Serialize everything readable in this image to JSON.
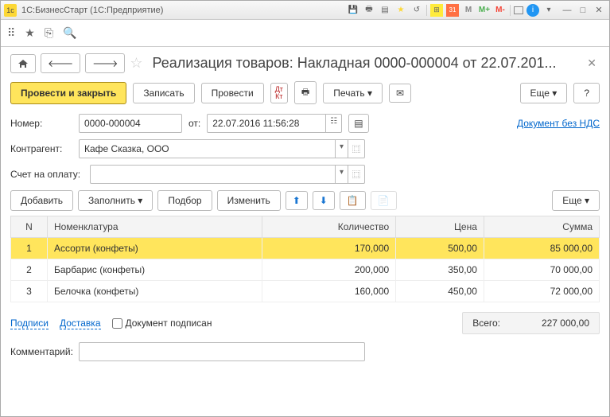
{
  "titlebar": {
    "title": "1С:БизнесСтарт  (1С:Предприятие)",
    "calendar_num": "31"
  },
  "header": {
    "doc_title": "Реализация товаров: Накладная 0000-000004 от 22.07.201..."
  },
  "cmd": {
    "post_close": "Провести и закрыть",
    "save": "Записать",
    "post": "Провести",
    "print": "Печать",
    "more": "Еще",
    "help": "?"
  },
  "form": {
    "number_label": "Номер:",
    "number_value": "0000-000004",
    "date_label": "от:",
    "date_value": "22.07.2016 11:56:28",
    "no_vat_link": "Документ без НДС",
    "contragent_label": "Контрагент:",
    "contragent_value": "Кафе Сказка, ООО",
    "invoice_label": "Счет на оплату:",
    "invoice_value": ""
  },
  "tbltool": {
    "add": "Добавить",
    "fill": "Заполнить",
    "pick": "Подбор",
    "change": "Изменить",
    "more": "Еще"
  },
  "table": {
    "cols": {
      "n": "N",
      "nom": "Номенклатура",
      "qty": "Количество",
      "price": "Цена",
      "sum": "Сумма"
    },
    "rows": [
      {
        "n": "1",
        "nom": "Ассорти (конфеты)",
        "qty": "170,000",
        "price": "500,00",
        "sum": "85 000,00",
        "selected": true
      },
      {
        "n": "2",
        "nom": "Барбарис (конфеты)",
        "qty": "200,000",
        "price": "350,00",
        "sum": "70 000,00",
        "selected": false
      },
      {
        "n": "3",
        "nom": "Белочка (конфеты)",
        "qty": "160,000",
        "price": "450,00",
        "sum": "72 000,00",
        "selected": false
      }
    ]
  },
  "bottom": {
    "sign_link": "Подписи",
    "delivery_link": "Доставка",
    "signed_label": "Документ подписан",
    "total_label": "Всего:",
    "total_value": "227 000,00",
    "comment_label": "Комментарий:",
    "comment_value": ""
  }
}
